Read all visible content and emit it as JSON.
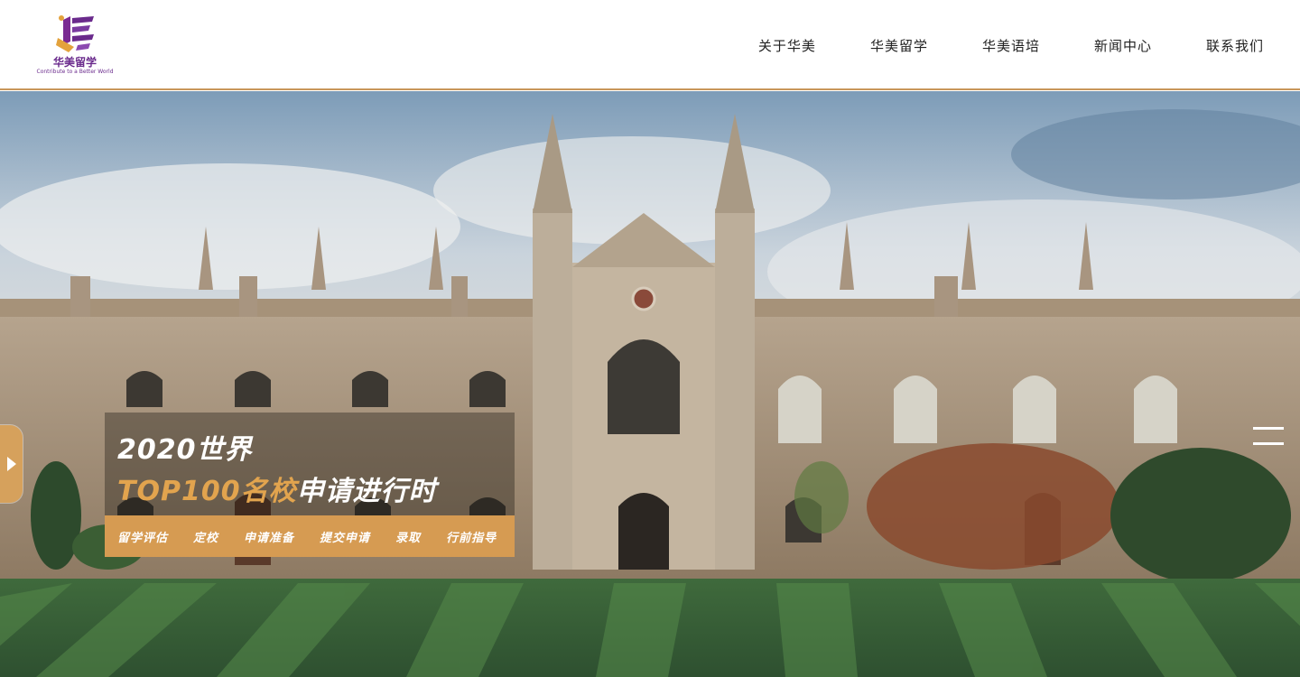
{
  "logo": {
    "name": "华美留学",
    "tagline": "Contribute to a Better World"
  },
  "nav": {
    "items": [
      "关于华美",
      "华美留学",
      "华美语培",
      "新闻中心",
      "联系我们"
    ]
  },
  "hero": {
    "headline_line1": "2020世界",
    "headline_highlight": "TOP100名校",
    "headline_rest": "申请进行时",
    "steps": [
      "留学评估",
      "定校",
      "申请准备",
      "提交申请",
      "录取",
      "行前指导"
    ]
  },
  "colors": {
    "accent": "#d69b52",
    "brand_purple": "#6a2a8c",
    "header_border": "#c8965a"
  },
  "icons": [
    "play-arrow-icon",
    "menu-icon",
    "logo-icon"
  ]
}
